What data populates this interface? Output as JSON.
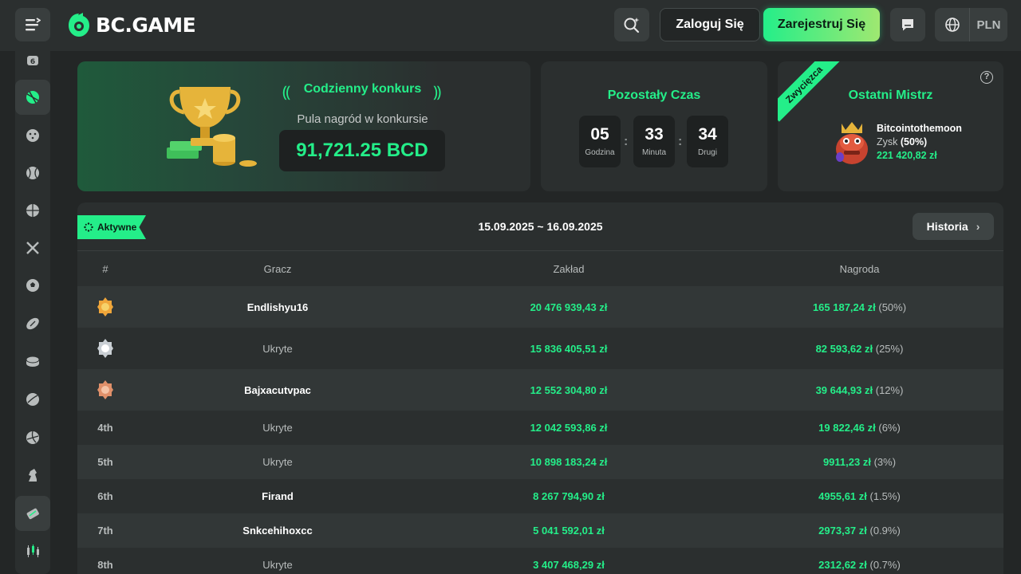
{
  "header": {
    "logo_text": "BC.GAME",
    "login_label": "Zaloguj Się",
    "register_label": "Zarejestruj Się",
    "currency": "PLN"
  },
  "contest": {
    "title": "Codzienny konkurs",
    "pool_label": "Pula nagród w konkursie",
    "pool_amount": "91,721.25 BCD"
  },
  "timer": {
    "title": "Pozostały Czas",
    "hours": "05",
    "hours_label": "Godzina",
    "minutes": "33",
    "minutes_label": "Minuta",
    "seconds": "34",
    "seconds_label": "Drugi"
  },
  "winner": {
    "ribbon": "Zwycięzca",
    "title": "Ostatni Mistrz",
    "help": "?",
    "name": "Bitcointothemoon",
    "profit_label": "Zysk",
    "profit_pct": "(50%)",
    "amount": "221 420,82 zł"
  },
  "board": {
    "active_label": "Aktywne",
    "date_range": "15.09.2025 ~ 16.09.2025",
    "history_label": "Historia",
    "columns": {
      "rank": "#",
      "player": "Gracz",
      "bet": "Zakład",
      "prize": "Nagroda"
    },
    "rows": [
      {
        "rank": "",
        "medal": "gold",
        "player": "Endlishyu16",
        "hidden": false,
        "bet": "20 476 939,43 zł",
        "prize": "165 187,24 zł",
        "pct": "(50%)"
      },
      {
        "rank": "",
        "medal": "silver",
        "player": "Ukryte",
        "hidden": true,
        "bet": "15 836 405,51 zł",
        "prize": "82 593,62 zł",
        "pct": "(25%)"
      },
      {
        "rank": "",
        "medal": "bronze",
        "player": "Bajxacutvpac",
        "hidden": false,
        "bet": "12 552 304,80 zł",
        "prize": "39 644,93 zł",
        "pct": "(12%)"
      },
      {
        "rank": "4th",
        "medal": "",
        "player": "Ukryte",
        "hidden": true,
        "bet": "12 042 593,86 zł",
        "prize": "19 822,46 zł",
        "pct": "(6%)"
      },
      {
        "rank": "5th",
        "medal": "",
        "player": "Ukryte",
        "hidden": true,
        "bet": "10 898 183,24 zł",
        "prize": "9911,23 zł",
        "pct": "(3%)"
      },
      {
        "rank": "6th",
        "medal": "",
        "player": "Firand",
        "hidden": false,
        "bet": "8 267 794,90 zł",
        "prize": "4955,61 zł",
        "pct": "(1.5%)"
      },
      {
        "rank": "7th",
        "medal": "",
        "player": "Snkcehihoxcc",
        "hidden": false,
        "bet": "5 041 592,01 zł",
        "prize": "2973,37 zł",
        "pct": "(0.9%)"
      },
      {
        "rank": "8th",
        "medal": "",
        "player": "Ukryte",
        "hidden": true,
        "bet": "3 407 468,29 zł",
        "prize": "2312,62 zł",
        "pct": "(0.7%)"
      }
    ]
  },
  "sidebar_icons": [
    "casino-icon",
    "tennis-ball-icon",
    "cricket-icon",
    "baseball-icon",
    "basketball-icon",
    "crossed-swords-icon",
    "soccer-icon",
    "rugby-icon",
    "hockey-puck-icon",
    "volleyball-ball-icon",
    "volleyball-icon",
    "chess-knight-icon",
    "ticket-icon",
    "candlestick-icon"
  ],
  "colors": {
    "accent": "#24ee89",
    "bg": "#232626",
    "panel": "#2b2f2f"
  }
}
